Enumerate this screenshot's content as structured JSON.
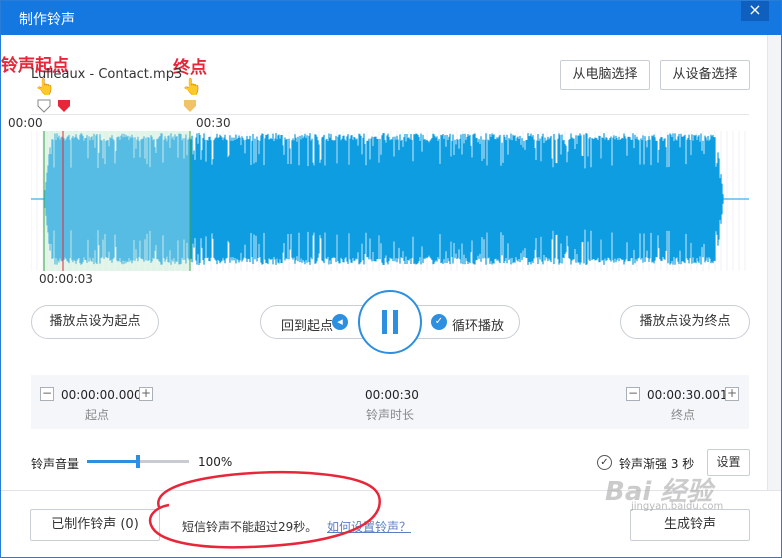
{
  "window": {
    "title": "制作铃声",
    "close": "×"
  },
  "file": {
    "name": "Lulleaux - Contact.mp3"
  },
  "buttons": {
    "from_pc": "从电脑选择",
    "from_device": "从设备选择",
    "set_start": "播放点设为起点",
    "back_to_start": "回到起点",
    "loop_play": "循环播放",
    "set_end": "播放点设为终点",
    "made_ringtones": "已制作铃声 (0)",
    "settings": "设置",
    "generate": "生成铃声"
  },
  "annotations": {
    "start_label": "铃声起点",
    "end_label": "终点"
  },
  "timeline": {
    "t0": "00:00",
    "t30": "00:30",
    "cursor_time": "00:00:03"
  },
  "range": {
    "start": "00:00:00.000",
    "start_label": "起点",
    "duration": "00:00:30",
    "duration_label": "铃声时长",
    "end": "00:00:30.001",
    "end_label": "终点",
    "minus": "−",
    "plus": "+"
  },
  "volume": {
    "label": "铃声音量",
    "value": "100%",
    "fraction": 0.5
  },
  "fade": {
    "label": "铃声渐强 3 秒",
    "checked": true
  },
  "tips": {
    "sms": "短信铃声不能超过29秒。",
    "how_link": "如何设置铃声？"
  },
  "colors": {
    "titlebar": "#1578e0",
    "wave": "#0d9de0",
    "selection": "#dff4e6",
    "start_marker": "#e8263a",
    "end_marker": "#f2c26a",
    "annotation": "#e8263a"
  },
  "watermark": "Bai 经验 jingyan.baidu.com"
}
